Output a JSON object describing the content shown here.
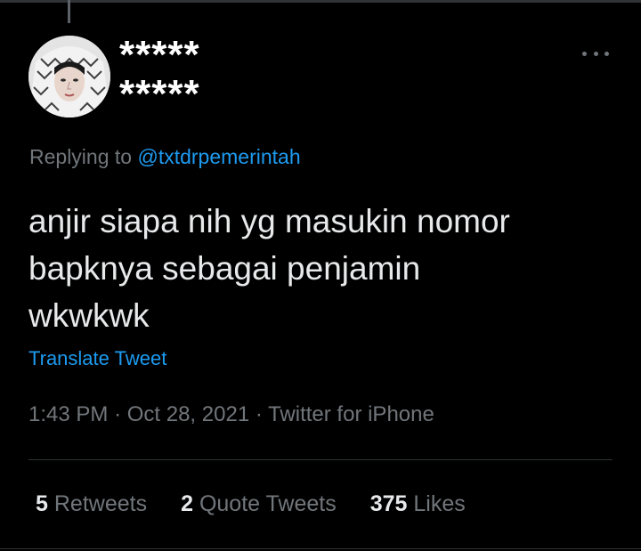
{
  "author": {
    "display_name_censored": "*****",
    "handle_censored": "*****",
    "display_name_underlay": "",
    "handle_underlay": "",
    "avatar_icon": "user-avatar"
  },
  "reply": {
    "prefix": "Replying to",
    "mention": "@txtdrpemerintah"
  },
  "tweet": {
    "lines": [
      "anjir siapa nih yg masukin nomor",
      "bapknya sebagai penjamin",
      "wkwkwk"
    ],
    "translate_label": "Translate Tweet"
  },
  "meta": {
    "time": "1:43 PM",
    "separator": "·",
    "date": "Oct 28, 2021",
    "source": "Twitter for iPhone"
  },
  "stats": {
    "retweets_count": "5",
    "retweets_label": "Retweets",
    "quotes_count": "2",
    "quotes_label": "Quote Tweets",
    "likes_count": "375",
    "likes_label": "Likes"
  },
  "colors": {
    "background": "#000000",
    "text_primary": "#e7e9ea",
    "text_secondary": "#71767b",
    "accent_blue": "#1d9bf0",
    "divider": "#2f3336"
  }
}
